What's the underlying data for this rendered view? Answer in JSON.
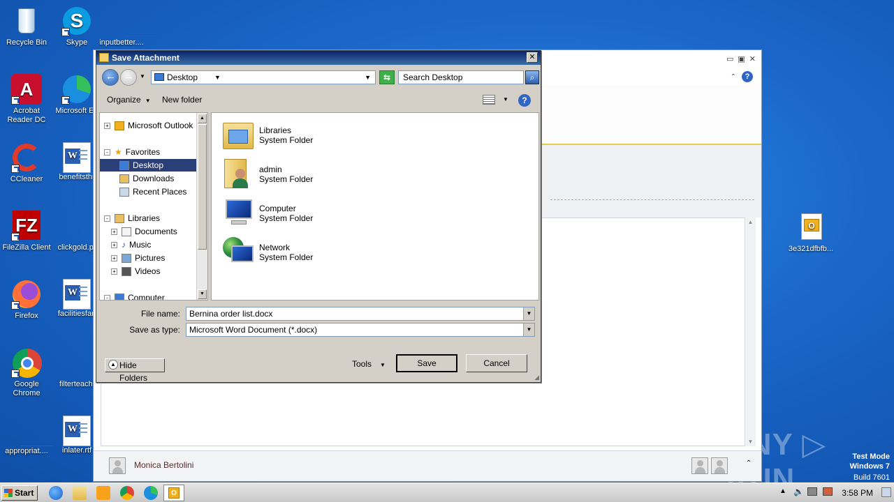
{
  "desktop": {
    "icons": [
      {
        "label": "Recycle Bin"
      },
      {
        "label": "Skype"
      },
      {
        "label": "inputbetter...."
      },
      {
        "label": "Acrobat Reader DC"
      },
      {
        "label": "Microsoft Ed"
      },
      {
        "label": "CCleaner"
      },
      {
        "label": "benefitsthr"
      },
      {
        "label": "FileZilla Client"
      },
      {
        "label": "clickgold.pr"
      },
      {
        "label": "Firefox"
      },
      {
        "label": "facilitiesfan"
      },
      {
        "label": "Google Chrome"
      },
      {
        "label": "filterteachi"
      },
      {
        "label": "appropriat...."
      },
      {
        "label": "inlater.rtf"
      },
      {
        "label": "3e321dfbfb..."
      }
    ],
    "watermark": {
      "line1": "Test Mode",
      "line2": "Windows 7",
      "line3": "Build 7601"
    },
    "anyrun": "ANY ▷ RUN"
  },
  "mail": {
    "sender": "Monica Bertolini"
  },
  "dialog": {
    "title": "Save Attachment",
    "location": "Desktop",
    "search_placeholder": "Search Desktop",
    "toolbar": {
      "organize": "Organize",
      "new_folder": "New folder"
    },
    "tree": [
      {
        "label": "Microsoft Outlook",
        "expander": "+"
      },
      {
        "label": "Favorites",
        "expander": "-"
      },
      {
        "label": "Desktop",
        "selected": true
      },
      {
        "label": "Downloads"
      },
      {
        "label": "Recent Places"
      },
      {
        "label": "Libraries",
        "expander": "-"
      },
      {
        "label": "Documents",
        "expander": "+"
      },
      {
        "label": "Music",
        "expander": "+"
      },
      {
        "label": "Pictures",
        "expander": "+"
      },
      {
        "label": "Videos",
        "expander": "+"
      },
      {
        "label": "Computer",
        "expander": "-"
      }
    ],
    "items": [
      {
        "name": "Libraries",
        "type": "System Folder"
      },
      {
        "name": "admin",
        "type": "System Folder"
      },
      {
        "name": "Computer",
        "type": "System Folder"
      },
      {
        "name": "Network",
        "type": "System Folder"
      }
    ],
    "file_name_label": "File name:",
    "file_name": "Bernina order list.docx",
    "save_type_label": "Save as type:",
    "save_type": "Microsoft Word Document (*.docx)",
    "hide_folders": "Hide Folders",
    "tools": "Tools",
    "save": "Save",
    "cancel": "Cancel"
  },
  "taskbar": {
    "start": "Start",
    "clock": "3:58 PM"
  }
}
